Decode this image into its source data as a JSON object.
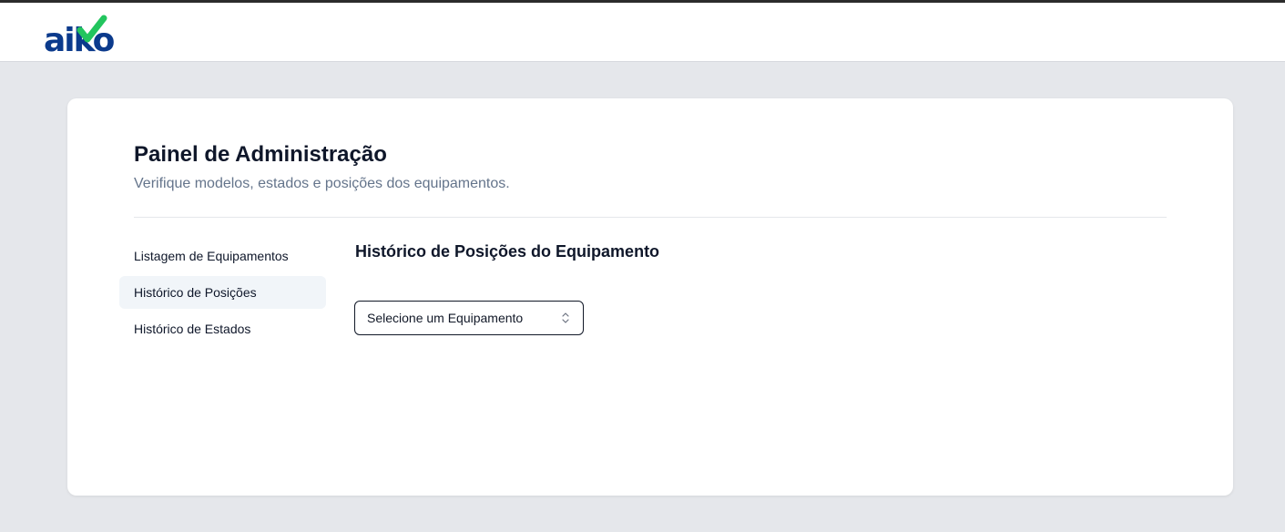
{
  "header": {
    "logo_text": "aiko",
    "logo_icon": "checkmark-icon",
    "colors": {
      "brand_blue": "#0b3a8c",
      "brand_green": "#22c55e"
    }
  },
  "card": {
    "title": "Painel de Administração",
    "subtitle": "Verifique modelos, estados e posições dos equipamentos."
  },
  "nav": {
    "items": [
      {
        "label": "Listagem de Equipamentos",
        "active": false
      },
      {
        "label": "Histórico de Posições",
        "active": true
      },
      {
        "label": "Histórico de Estados",
        "active": false
      }
    ]
  },
  "main": {
    "section_title": "Histórico de Posições do Equipamento",
    "equipment_select": {
      "value": "Selecione um Equipamento",
      "icon": "chevron-up-down-icon"
    }
  }
}
